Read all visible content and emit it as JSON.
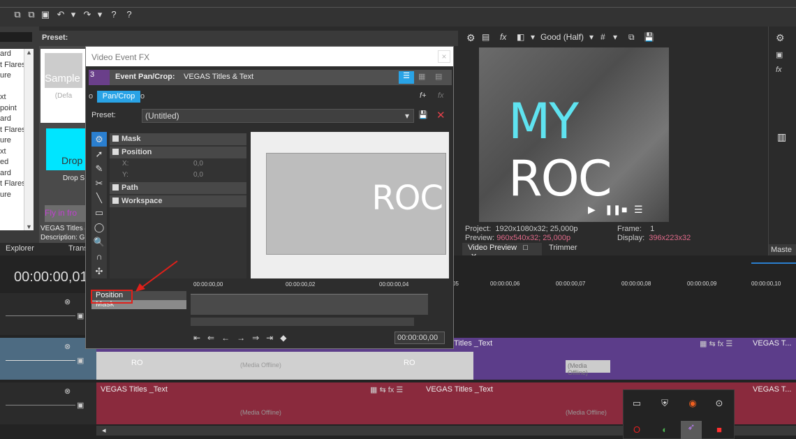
{
  "topbar": {
    "icons": [
      "copy-icon",
      "paste-icon",
      "undo-icon",
      "redo-icon",
      "help-icon"
    ]
  },
  "left_panel": {
    "preset_label": "Preset:",
    "list_items": [
      "ard",
      "t Flares",
      "ure",
      "",
      "xt",
      "point",
      "ard",
      "t Flares",
      "ure",
      "xt",
      "ed",
      "ard",
      "t Flares",
      "ure"
    ],
    "tile1_title": "Sample",
    "tile1_sub": "(Defa",
    "tile2_title": "Drop",
    "tile2_caption": "Drop S",
    "pink_text": "Fly in fro",
    "desc1": "VEGAS Titles &",
    "desc2": "Description: G",
    "tab_explorer": "Explorer",
    "tab_trans": "Trans"
  },
  "dialog": {
    "title": "Video Event FX",
    "close": "×",
    "badge": "3",
    "fx_label": "Event Pan/Crop:",
    "fx_name": "VEGAS Titles & Text",
    "chain_button": "Pan/Crop",
    "preset_label": "Preset:",
    "preset_value": "(Untitled)",
    "tree": {
      "mask": "Mask",
      "position": "Position",
      "x_label": "X:",
      "x_value": "0,0",
      "y_label": "Y:",
      "y_value": "0,0",
      "path": "Path",
      "workspace": "Workspace"
    },
    "canvas_text": "ROC",
    "keyframe_rows": [
      "Position",
      "Mask"
    ],
    "kf_ruler": [
      "00:00:00,00",
      "00:00:00,02",
      "00:00:00,04"
    ],
    "kf_time": "00:00:00,00"
  },
  "video_preview": {
    "quality": "Good (Half)",
    "title_text": "MY ROC",
    "project_label": "Project:",
    "project_value": "1920x1080x32; 25,000p",
    "preview_label": "Preview:",
    "preview_value": "960x540x32; 25,000p",
    "frame_label": "Frame:",
    "frame_value": "1",
    "display_label": "Display:",
    "display_value": "396x223x32",
    "tab_preview": "Video Preview",
    "tab_trimmer": "Trimmer",
    "right_tab": "Maste"
  },
  "timeline": {
    "current_time": "00:00:00,01",
    "ruler": [
      "05",
      "00:00:00,06",
      "00:00:00,07",
      "00:00:00,08",
      "00:00:00,09",
      "00:00:00,10"
    ],
    "clip_title": "VEGAS Titles _Text",
    "clip_title_short": "Titles _Text",
    "clip_title_end": "VEGAS T...",
    "media_offline": "(Media Offline)",
    "roc": "RO"
  },
  "colors": {
    "accent": "#29a3e6",
    "purple_track": "#5c3d8a",
    "red_track": "#8a2a3d",
    "teal_title": "#6ee6e6"
  }
}
